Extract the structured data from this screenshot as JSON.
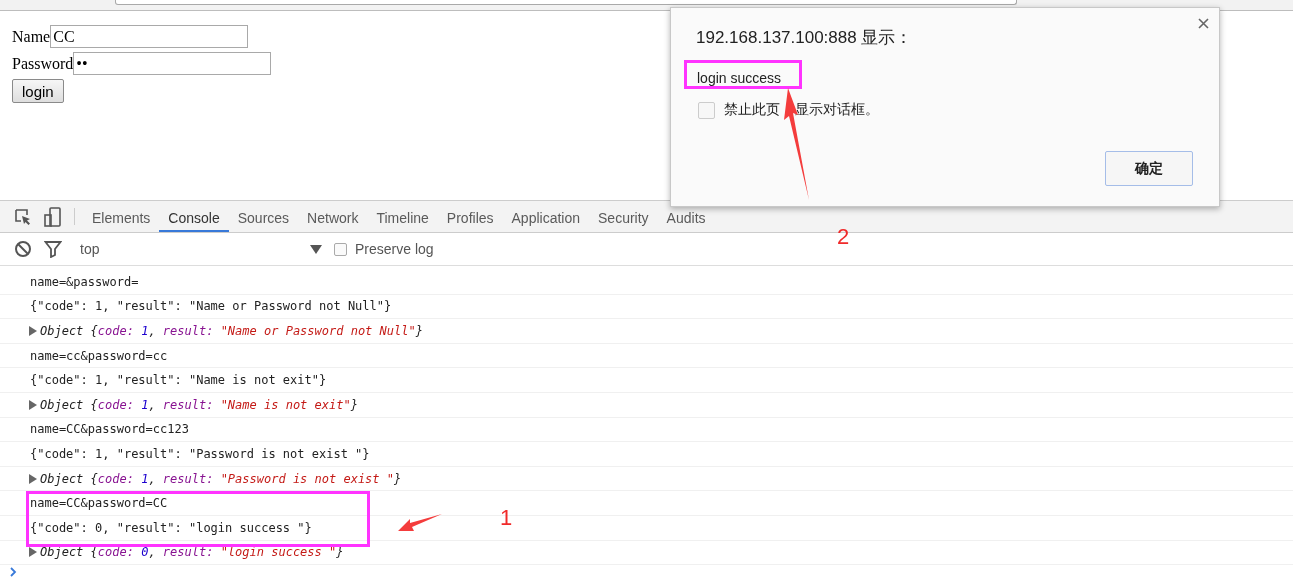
{
  "page": {
    "form": {
      "name_label": "Name",
      "name_value": "CC",
      "password_label": "Password",
      "password_value": "••",
      "submit": "login"
    }
  },
  "devtools": {
    "tabs": [
      {
        "label": "Elements",
        "selected": false
      },
      {
        "label": "Console",
        "selected": true
      },
      {
        "label": "Sources",
        "selected": false
      },
      {
        "label": "Network",
        "selected": false
      },
      {
        "label": "Timeline",
        "selected": false
      },
      {
        "label": "Profiles",
        "selected": false
      },
      {
        "label": "Application",
        "selected": false
      },
      {
        "label": "Security",
        "selected": false
      },
      {
        "label": "Audits",
        "selected": false
      }
    ],
    "toolbar": {
      "context": "top",
      "preserve_log": {
        "label": "Preserve log",
        "checked": false
      }
    },
    "console": [
      {
        "kind": "text",
        "text": "name=&password="
      },
      {
        "kind": "text",
        "text": "{\"code\": 1, \"result\": \"Name or Password not Null\"}"
      },
      {
        "kind": "object",
        "expanded": false,
        "parts": [
          {
            "kind": "plain",
            "text": "Object {"
          },
          {
            "kind": "key",
            "text": "code:"
          },
          {
            "kind": "number",
            "text": " 1"
          },
          {
            "kind": "plain",
            "text": ", "
          },
          {
            "kind": "key",
            "text": "result:"
          },
          {
            "kind": "string",
            "text": " \"Name or Password not Null\""
          },
          {
            "kind": "plain",
            "text": "}"
          }
        ]
      },
      {
        "kind": "text",
        "text": "name=cc&password=cc"
      },
      {
        "kind": "text",
        "text": "{\"code\": 1, \"result\": \"Name is not exit\"}"
      },
      {
        "kind": "object",
        "expanded": false,
        "parts": [
          {
            "kind": "plain",
            "text": "Object {"
          },
          {
            "kind": "key",
            "text": "code:"
          },
          {
            "kind": "number",
            "text": " 1"
          },
          {
            "kind": "plain",
            "text": ", "
          },
          {
            "kind": "key",
            "text": "result:"
          },
          {
            "kind": "string",
            "text": " \"Name is not exit\""
          },
          {
            "kind": "plain",
            "text": "}"
          }
        ]
      },
      {
        "kind": "text",
        "text": "name=CC&password=cc123"
      },
      {
        "kind": "text",
        "text": "{\"code\": 1, \"result\": \"Password is not exist \"}"
      },
      {
        "kind": "object",
        "expanded": false,
        "parts": [
          {
            "kind": "plain",
            "text": "Object {"
          },
          {
            "kind": "key",
            "text": "code:"
          },
          {
            "kind": "number",
            "text": " 1"
          },
          {
            "kind": "plain",
            "text": ", "
          },
          {
            "kind": "key",
            "text": "result:"
          },
          {
            "kind": "string",
            "text": " \"Password is not exist \""
          },
          {
            "kind": "plain",
            "text": "}"
          }
        ]
      },
      {
        "kind": "text",
        "text": "name=CC&password=CC"
      },
      {
        "kind": "text",
        "text": "{\"code\": 0, \"result\": \"login success \"}"
      },
      {
        "kind": "object",
        "expanded": false,
        "parts": [
          {
            "kind": "plain",
            "text": "Object {"
          },
          {
            "kind": "key",
            "text": "code:"
          },
          {
            "kind": "number",
            "text": " 0"
          },
          {
            "kind": "plain",
            "text": ", "
          },
          {
            "kind": "key",
            "text": "result:"
          },
          {
            "kind": "string",
            "text": " \"login success \""
          },
          {
            "kind": "plain",
            "text": "}"
          }
        ]
      }
    ]
  },
  "dialog": {
    "title": "192.168.137.100:888 显示：",
    "message": "login success",
    "checkbox": {
      "label_parts": [
        "禁止此页",
        "显示对话框。"
      ],
      "checked": false
    },
    "ok": "确定"
  },
  "annotations": [
    {
      "kind": "number",
      "text": "1"
    },
    {
      "kind": "number",
      "text": "2"
    }
  ]
}
